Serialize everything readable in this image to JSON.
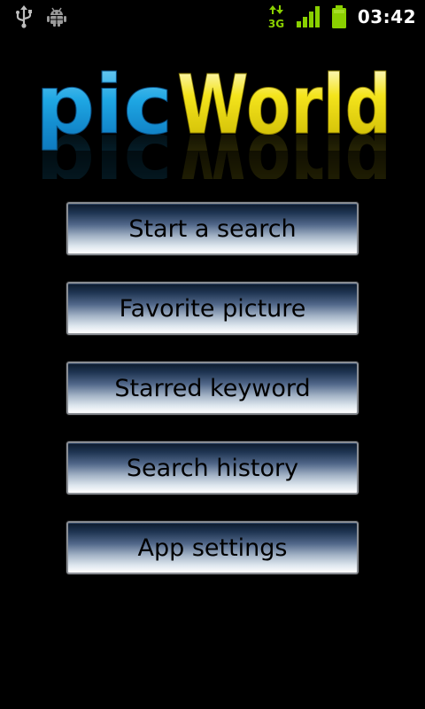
{
  "status_bar": {
    "left_icons": [
      "usb-icon",
      "android-debug-icon"
    ],
    "network_label": "3G",
    "right_icons": [
      "data-transfer-icon",
      "signal-icon",
      "battery-icon"
    ],
    "time": "03:42",
    "colors": {
      "accent": "#8ad000"
    }
  },
  "logo": {
    "part1": "pic",
    "part2": "World",
    "colors": {
      "pic": "#1aa3e0",
      "world": "#f0dd1a"
    }
  },
  "menu": {
    "items": [
      {
        "id": "start-search",
        "label": "Start a search"
      },
      {
        "id": "favorite-picture",
        "label": "Favorite picture"
      },
      {
        "id": "starred-keyword",
        "label": "Starred keyword"
      },
      {
        "id": "search-history",
        "label": "Search history"
      },
      {
        "id": "app-settings",
        "label": "App settings"
      }
    ]
  }
}
